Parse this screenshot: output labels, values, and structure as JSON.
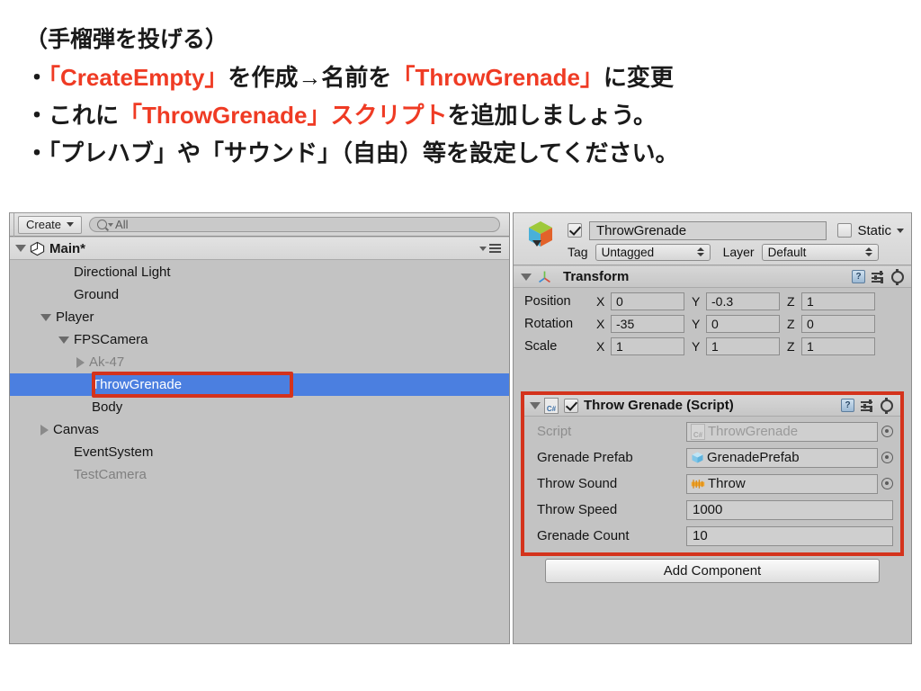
{
  "slide": {
    "lines": [
      {
        "segments": [
          {
            "text": "（手榴弾を投げる）",
            "color": "black"
          }
        ]
      },
      {
        "segments": [
          {
            "text": "・",
            "color": "black"
          },
          {
            "text": "「CreateEmpty」",
            "color": "red"
          },
          {
            "text": "を作成→名前を",
            "color": "black"
          },
          {
            "text": "「ThrowGrenade」",
            "color": "red"
          },
          {
            "text": "に変更",
            "color": "black"
          }
        ]
      },
      {
        "segments": [
          {
            "text": "・これに",
            "color": "black"
          },
          {
            "text": "「ThrowGrenade」スクリプト",
            "color": "red"
          },
          {
            "text": "を追加しましょう。",
            "color": "black"
          }
        ]
      },
      {
        "segments": [
          {
            "text": "・「プレハブ」や「サウンド」（自由）等を設定してください。",
            "color": "black"
          }
        ]
      }
    ],
    "accent_red": "#ef3b24",
    "text_black": "#1a1a1a"
  },
  "hierarchy": {
    "toolbar": {
      "create_label": "Create",
      "search_placeholder": "All"
    },
    "scene": {
      "name": "Main*"
    },
    "items": [
      {
        "label": "Directional Light",
        "indent": 2,
        "caret": "none",
        "state": "normal"
      },
      {
        "label": "Ground",
        "indent": 2,
        "caret": "none",
        "state": "normal"
      },
      {
        "label": "Player",
        "indent": 1,
        "caret": "open",
        "state": "normal"
      },
      {
        "label": "FPSCamera",
        "indent": 2,
        "caret": "open",
        "state": "normal"
      },
      {
        "label": "Ak-47",
        "indent": 3,
        "caret": "closed",
        "state": "dim"
      },
      {
        "label": "ThrowGrenade",
        "indent": 3,
        "caret": "none",
        "state": "selected"
      },
      {
        "label": "Body",
        "indent": 3,
        "caret": "none",
        "state": "normal"
      },
      {
        "label": "Canvas",
        "indent": 1,
        "caret": "closed",
        "state": "normal"
      },
      {
        "label": "EventSystem",
        "indent": 2,
        "caret": "none",
        "state": "normal"
      },
      {
        "label": "TestCamera",
        "indent": 2,
        "caret": "none",
        "state": "dim"
      }
    ],
    "selection_color": "#4b7fe0",
    "highlight_color": "#d4331c"
  },
  "inspector": {
    "gameobject": {
      "enabled_checkbox": true,
      "name": "ThrowGrenade",
      "static_label": "Static",
      "static_checked": false,
      "tag_label": "Tag",
      "tag_value": "Untagged",
      "layer_label": "Layer",
      "layer_value": "Default"
    },
    "transform": {
      "title": "Transform",
      "rows": [
        {
          "name": "Position",
          "x": "0",
          "y": "-0.3",
          "z": "1"
        },
        {
          "name": "Rotation",
          "x": "-35",
          "y": "0",
          "z": "0"
        },
        {
          "name": "Scale",
          "x": "1",
          "y": "1",
          "z": "1"
        }
      ],
      "axis_labels": [
        "X",
        "Y",
        "Z"
      ]
    },
    "script_component": {
      "title": "Throw Grenade (Script)",
      "enabled_checkbox": true,
      "fields": [
        {
          "label": "Script",
          "value": "ThrowGrenade",
          "kind": "object",
          "icon": "cs-file-icon",
          "disabled": true
        },
        {
          "label": "Grenade Prefab",
          "value": "GrenadePrefab",
          "kind": "object",
          "icon": "prefab-cube-icon",
          "disabled": false
        },
        {
          "label": "Throw Sound",
          "value": "Throw",
          "kind": "object",
          "icon": "audio-clip-icon",
          "disabled": false
        },
        {
          "label": "Throw Speed",
          "value": "1000",
          "kind": "number",
          "icon": "",
          "disabled": false
        },
        {
          "label": "Grenade Count",
          "value": "10",
          "kind": "number",
          "icon": "",
          "disabled": false
        }
      ],
      "highlight_color": "#d4331c"
    },
    "add_component_label": "Add Component",
    "help_icon_glyph": "?"
  }
}
